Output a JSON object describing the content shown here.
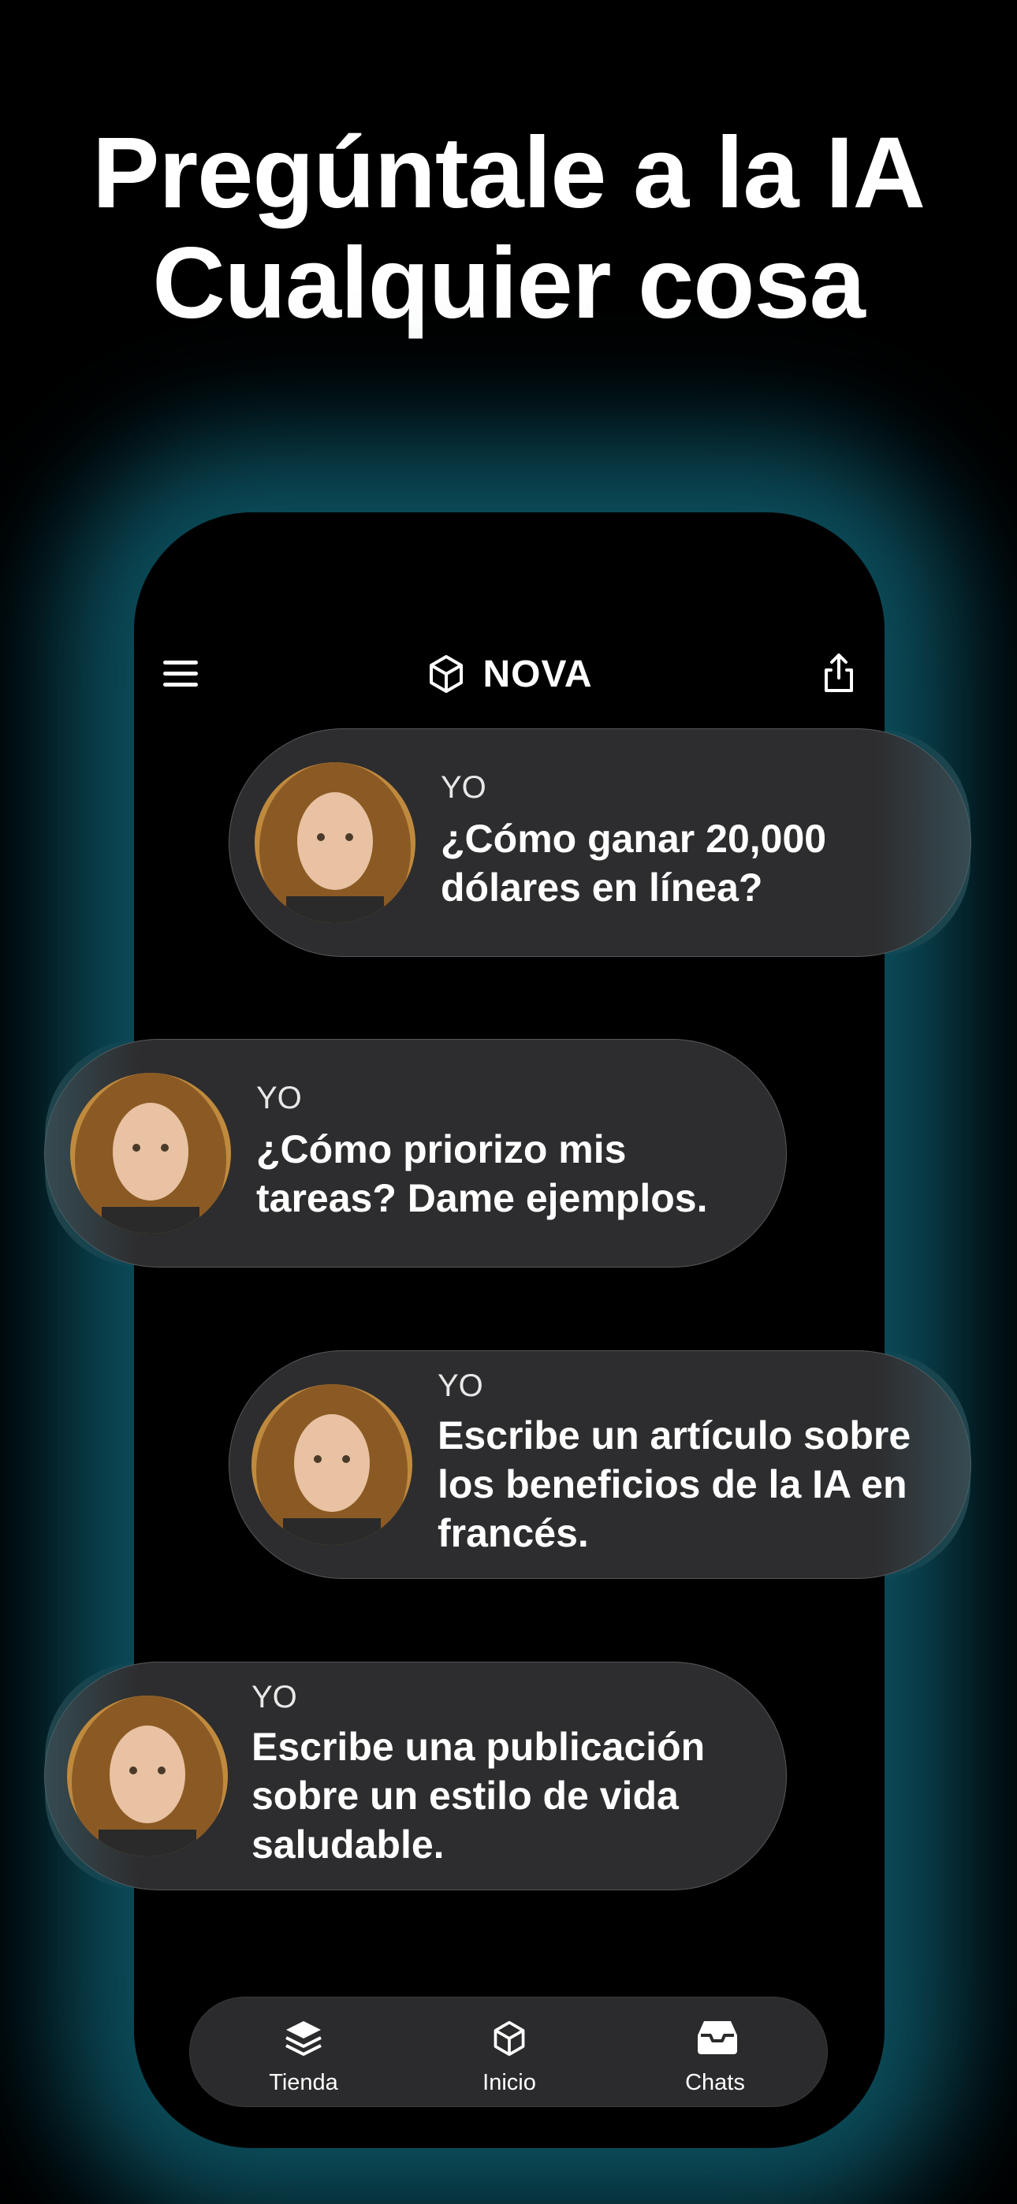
{
  "headline": {
    "line1": "Pregúntale a la IA",
    "line2": "Cualquier cosa"
  },
  "app": {
    "brand": "NOVA",
    "icons": {
      "menu": "hamburger-icon",
      "share": "share-icon",
      "logo": "nova-logo-icon"
    }
  },
  "messages": [
    {
      "sender": "YO",
      "line1": "¿Cómo ganar 20,000",
      "line2": "dólares en línea?",
      "line3": ""
    },
    {
      "sender": "YO",
      "line1": "¿Cómo priorizo mis",
      "line2": "tareas? Dame ejemplos.",
      "line3": ""
    },
    {
      "sender": "YO",
      "line1": "Escribe un artículo sobre",
      "line2": "los beneficios de la IA en",
      "line3": "francés."
    },
    {
      "sender": "YO",
      "line1": "Escribe una publicación",
      "line2": "sobre un estilo de vida",
      "line3": "saludable."
    }
  ],
  "tabbar": {
    "tabs": [
      {
        "label": "Tienda",
        "icon": "layers-icon"
      },
      {
        "label": "Inicio",
        "icon": "nova-logo-icon"
      },
      {
        "label": "Chats",
        "icon": "inbox-icon"
      }
    ]
  },
  "colors": {
    "background": "#000000",
    "bubble": "#2d2d2f",
    "glow": "#147888",
    "text": "#ffffff"
  }
}
